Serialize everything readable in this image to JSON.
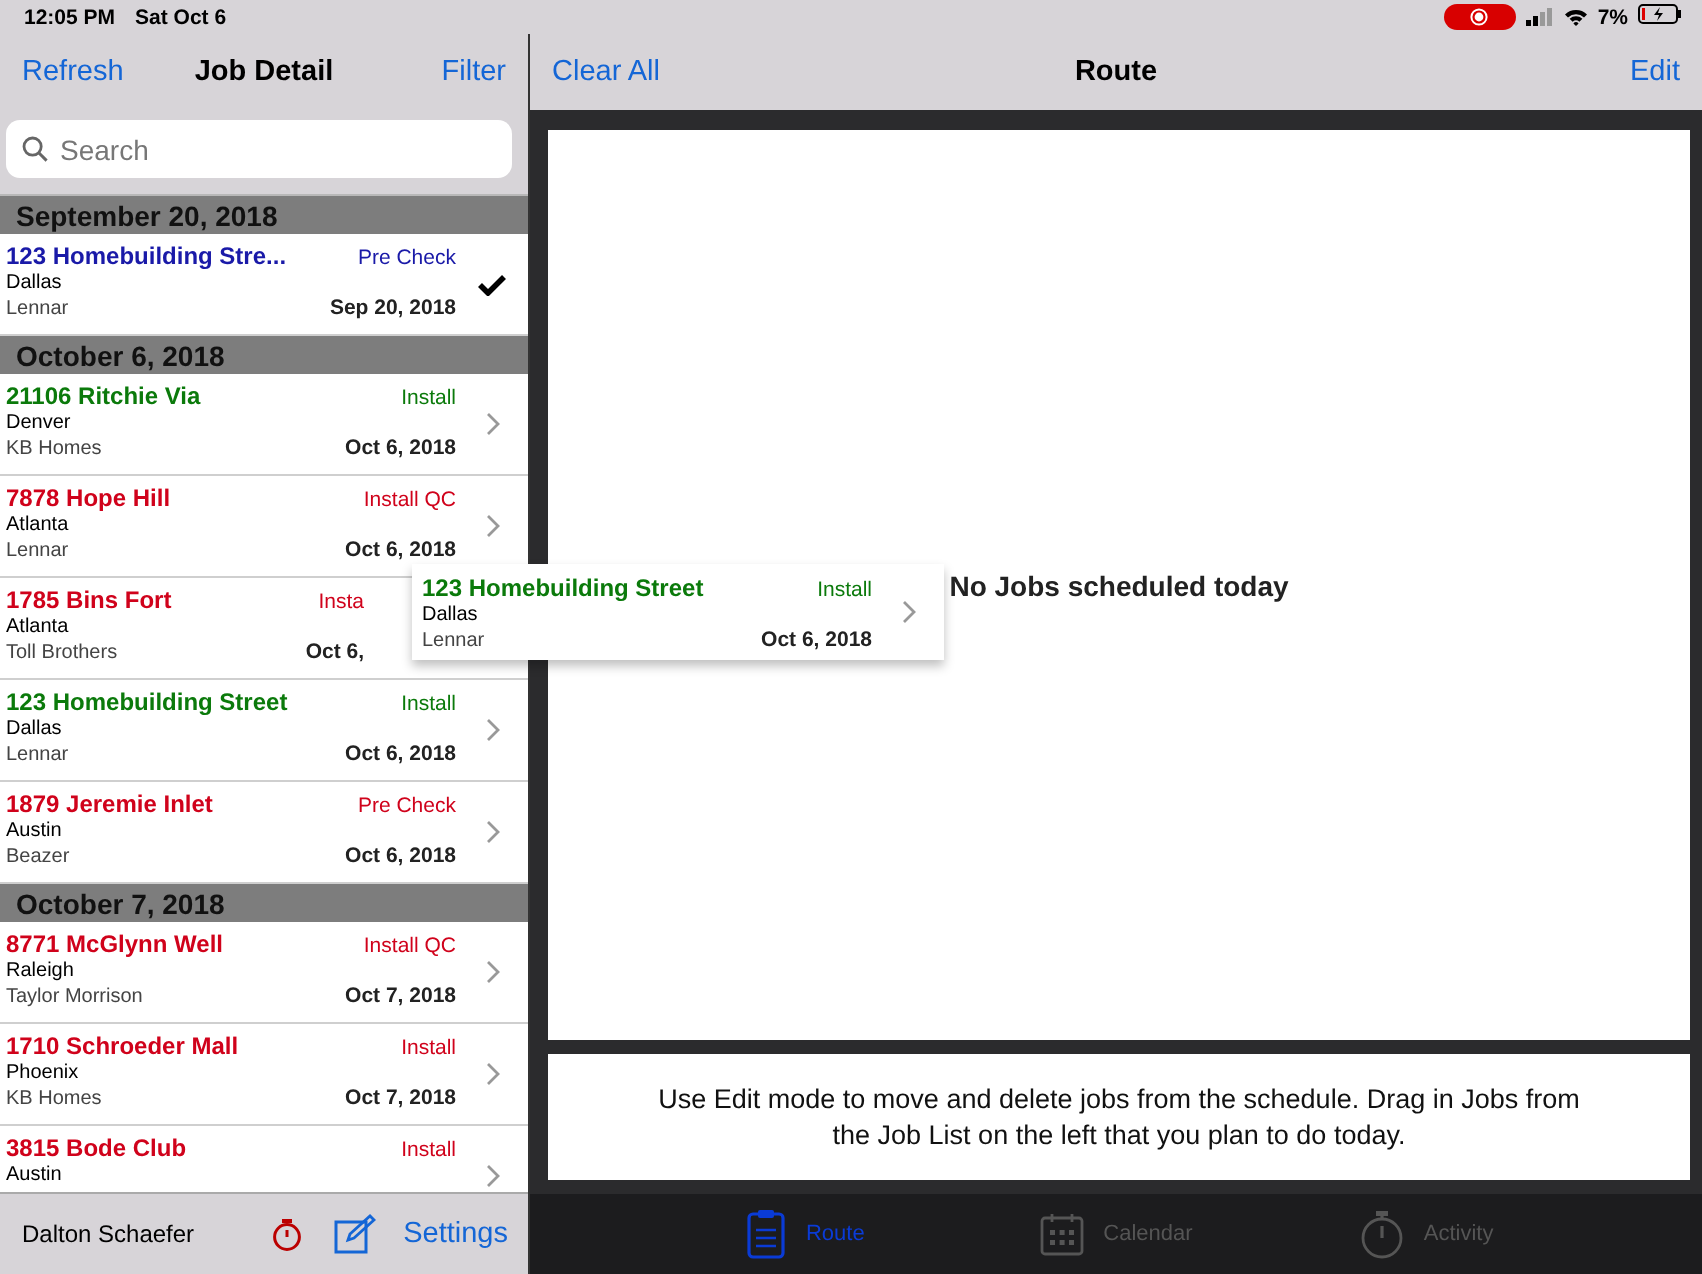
{
  "status_bar": {
    "time": "12:05 PM",
    "date": "Sat Oct 6",
    "recording": true,
    "battery": "7%"
  },
  "left_nav": {
    "left_button": "Refresh",
    "title": "Job Detail",
    "right_button": "Filter"
  },
  "search": {
    "placeholder": "Search"
  },
  "sections": [
    {
      "title": "September 20, 2018",
      "jobs": [
        {
          "address": "123 Homebuilding Stre...",
          "status": "Pre Check",
          "city": "Dallas",
          "builder": "Lennar",
          "date": "Sep 20, 2018",
          "color": "#1a1aa8",
          "checked": true,
          "covered": false
        }
      ]
    },
    {
      "title": "October 6, 2018",
      "jobs": [
        {
          "address": "21106 Ritchie Via",
          "status": "Install",
          "city": "Denver",
          "builder": "KB Homes",
          "date": "Oct 6, 2018",
          "color": "#0b7a0b",
          "checked": false,
          "covered": false
        },
        {
          "address": "7878 Hope Hill",
          "status": "Install QC",
          "city": "Atlanta",
          "builder": "Lennar",
          "date": "Oct 6, 2018",
          "color": "#d0021b",
          "checked": false,
          "covered": false
        },
        {
          "address": "1785 Bins Fort",
          "status": "Insta",
          "city": "Atlanta",
          "builder": "Toll Brothers",
          "date": "Oct 6,",
          "color": "#d0021b",
          "covered": true
        },
        {
          "address": "123 Homebuilding Street",
          "status": "Install",
          "city": "Dallas",
          "builder": "Lennar",
          "date": "Oct 6, 2018",
          "color": "#0b7a0b",
          "checked": false,
          "covered": false
        },
        {
          "address": "1879 Jeremie Inlet",
          "status": "Pre Check",
          "city": "Austin",
          "builder": "Beazer",
          "date": "Oct 6, 2018",
          "color": "#d0021b",
          "checked": false,
          "covered": false
        }
      ]
    },
    {
      "title": "October 7, 2018",
      "jobs": [
        {
          "address": "8771 McGlynn Well",
          "status": "Install QC",
          "city": "Raleigh",
          "builder": "Taylor Morrison",
          "date": "Oct 7, 2018",
          "color": "#d0021b",
          "checked": false,
          "covered": false
        },
        {
          "address": "1710 Schroeder Mall",
          "status": "Install",
          "city": "Phoenix",
          "builder": "KB Homes",
          "date": "Oct 7, 2018",
          "color": "#d0021b",
          "checked": false,
          "covered": false
        },
        {
          "address": "3815 Bode Club",
          "status": "Install",
          "city": "Austin",
          "color": "#d0021b",
          "checked": false,
          "covered": false
        }
      ]
    }
  ],
  "bottom_bar": {
    "user": "Dalton Schaefer",
    "settings": "Settings"
  },
  "right_nav": {
    "left_button": "Clear All",
    "title": "Route",
    "right_button": "Edit"
  },
  "route": {
    "empty_message": "No Jobs scheduled today",
    "hint": "Use Edit mode to move and delete jobs from the schedule. Drag in Jobs from the Job List on the left that you plan to do today."
  },
  "dragged_job": {
    "address": "123 Homebuilding Street",
    "status": "Install",
    "city": "Dallas",
    "builder": "Lennar",
    "date": "Oct 6, 2018",
    "color": "#0b7a0b"
  },
  "tabs": [
    {
      "label": "Route",
      "kind": "clipboard",
      "selected": true
    },
    {
      "label": "Calendar",
      "kind": "calendar",
      "selected": false
    },
    {
      "label": "Activity",
      "kind": "stopwatch",
      "selected": false
    }
  ]
}
